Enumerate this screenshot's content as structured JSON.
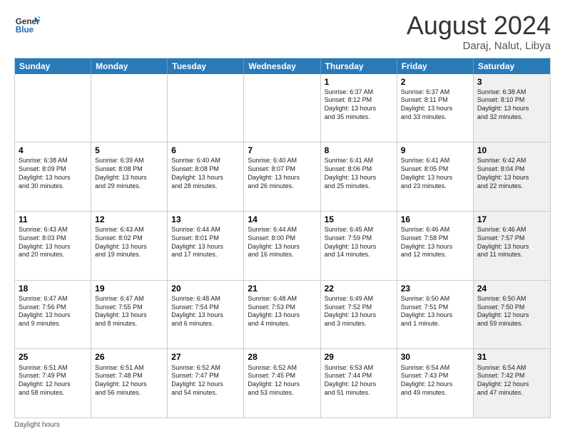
{
  "header": {
    "logo_general": "General",
    "logo_blue": "Blue",
    "month_title": "August 2024",
    "location": "Daraj, Nalut, Libya"
  },
  "days_of_week": [
    "Sunday",
    "Monday",
    "Tuesday",
    "Wednesday",
    "Thursday",
    "Friday",
    "Saturday"
  ],
  "footer": {
    "daylight_label": "Daylight hours"
  },
  "weeks": [
    [
      {
        "day": "",
        "text": "",
        "shaded": false
      },
      {
        "day": "",
        "text": "",
        "shaded": false
      },
      {
        "day": "",
        "text": "",
        "shaded": false
      },
      {
        "day": "",
        "text": "",
        "shaded": false
      },
      {
        "day": "1",
        "text": "Sunrise: 6:37 AM\nSunset: 8:12 PM\nDaylight: 13 hours\nand 35 minutes.",
        "shaded": false
      },
      {
        "day": "2",
        "text": "Sunrise: 6:37 AM\nSunset: 8:11 PM\nDaylight: 13 hours\nand 33 minutes.",
        "shaded": false
      },
      {
        "day": "3",
        "text": "Sunrise: 6:38 AM\nSunset: 8:10 PM\nDaylight: 13 hours\nand 32 minutes.",
        "shaded": true
      }
    ],
    [
      {
        "day": "4",
        "text": "Sunrise: 6:38 AM\nSunset: 8:09 PM\nDaylight: 13 hours\nand 30 minutes.",
        "shaded": false
      },
      {
        "day": "5",
        "text": "Sunrise: 6:39 AM\nSunset: 8:08 PM\nDaylight: 13 hours\nand 29 minutes.",
        "shaded": false
      },
      {
        "day": "6",
        "text": "Sunrise: 6:40 AM\nSunset: 8:08 PM\nDaylight: 13 hours\nand 28 minutes.",
        "shaded": false
      },
      {
        "day": "7",
        "text": "Sunrise: 6:40 AM\nSunset: 8:07 PM\nDaylight: 13 hours\nand 26 minutes.",
        "shaded": false
      },
      {
        "day": "8",
        "text": "Sunrise: 6:41 AM\nSunset: 8:06 PM\nDaylight: 13 hours\nand 25 minutes.",
        "shaded": false
      },
      {
        "day": "9",
        "text": "Sunrise: 6:41 AM\nSunset: 8:05 PM\nDaylight: 13 hours\nand 23 minutes.",
        "shaded": false
      },
      {
        "day": "10",
        "text": "Sunrise: 6:42 AM\nSunset: 8:04 PM\nDaylight: 13 hours\nand 22 minutes.",
        "shaded": true
      }
    ],
    [
      {
        "day": "11",
        "text": "Sunrise: 6:43 AM\nSunset: 8:03 PM\nDaylight: 13 hours\nand 20 minutes.",
        "shaded": false
      },
      {
        "day": "12",
        "text": "Sunrise: 6:43 AM\nSunset: 8:02 PM\nDaylight: 13 hours\nand 19 minutes.",
        "shaded": false
      },
      {
        "day": "13",
        "text": "Sunrise: 6:44 AM\nSunset: 8:01 PM\nDaylight: 13 hours\nand 17 minutes.",
        "shaded": false
      },
      {
        "day": "14",
        "text": "Sunrise: 6:44 AM\nSunset: 8:00 PM\nDaylight: 13 hours\nand 16 minutes.",
        "shaded": false
      },
      {
        "day": "15",
        "text": "Sunrise: 6:45 AM\nSunset: 7:59 PM\nDaylight: 13 hours\nand 14 minutes.",
        "shaded": false
      },
      {
        "day": "16",
        "text": "Sunrise: 6:46 AM\nSunset: 7:58 PM\nDaylight: 13 hours\nand 12 minutes.",
        "shaded": false
      },
      {
        "day": "17",
        "text": "Sunrise: 6:46 AM\nSunset: 7:57 PM\nDaylight: 13 hours\nand 11 minutes.",
        "shaded": true
      }
    ],
    [
      {
        "day": "18",
        "text": "Sunrise: 6:47 AM\nSunset: 7:56 PM\nDaylight: 13 hours\nand 9 minutes.",
        "shaded": false
      },
      {
        "day": "19",
        "text": "Sunrise: 6:47 AM\nSunset: 7:55 PM\nDaylight: 13 hours\nand 8 minutes.",
        "shaded": false
      },
      {
        "day": "20",
        "text": "Sunrise: 6:48 AM\nSunset: 7:54 PM\nDaylight: 13 hours\nand 6 minutes.",
        "shaded": false
      },
      {
        "day": "21",
        "text": "Sunrise: 6:48 AM\nSunset: 7:53 PM\nDaylight: 13 hours\nand 4 minutes.",
        "shaded": false
      },
      {
        "day": "22",
        "text": "Sunrise: 6:49 AM\nSunset: 7:52 PM\nDaylight: 13 hours\nand 3 minutes.",
        "shaded": false
      },
      {
        "day": "23",
        "text": "Sunrise: 6:50 AM\nSunset: 7:51 PM\nDaylight: 13 hours\nand 1 minute.",
        "shaded": false
      },
      {
        "day": "24",
        "text": "Sunrise: 6:50 AM\nSunset: 7:50 PM\nDaylight: 12 hours\nand 59 minutes.",
        "shaded": true
      }
    ],
    [
      {
        "day": "25",
        "text": "Sunrise: 6:51 AM\nSunset: 7:49 PM\nDaylight: 12 hours\nand 58 minutes.",
        "shaded": false
      },
      {
        "day": "26",
        "text": "Sunrise: 6:51 AM\nSunset: 7:48 PM\nDaylight: 12 hours\nand 56 minutes.",
        "shaded": false
      },
      {
        "day": "27",
        "text": "Sunrise: 6:52 AM\nSunset: 7:47 PM\nDaylight: 12 hours\nand 54 minutes.",
        "shaded": false
      },
      {
        "day": "28",
        "text": "Sunrise: 6:52 AM\nSunset: 7:45 PM\nDaylight: 12 hours\nand 53 minutes.",
        "shaded": false
      },
      {
        "day": "29",
        "text": "Sunrise: 6:53 AM\nSunset: 7:44 PM\nDaylight: 12 hours\nand 51 minutes.",
        "shaded": false
      },
      {
        "day": "30",
        "text": "Sunrise: 6:54 AM\nSunset: 7:43 PM\nDaylight: 12 hours\nand 49 minutes.",
        "shaded": false
      },
      {
        "day": "31",
        "text": "Sunrise: 6:54 AM\nSunset: 7:42 PM\nDaylight: 12 hours\nand 47 minutes.",
        "shaded": true
      }
    ]
  ]
}
